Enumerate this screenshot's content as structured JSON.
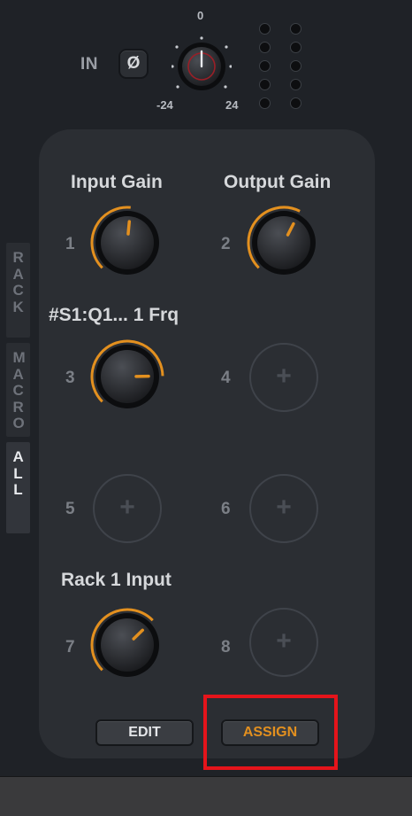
{
  "input": {
    "label": "IN",
    "phase_symbol": "Ø",
    "scale_top": "0",
    "scale_min": "-24",
    "scale_max": "24"
  },
  "side_tabs": [
    {
      "label": "RACK",
      "active": false
    },
    {
      "label": "MACRO",
      "active": false
    },
    {
      "label": "ALL",
      "active": true
    }
  ],
  "macros": [
    {
      "number": "1",
      "name": "Input Gain",
      "assigned": true,
      "value": 0.52
    },
    {
      "number": "2",
      "name": "Output Gain",
      "assigned": true,
      "value": 0.6
    },
    {
      "number": "3",
      "name": "#S1:Q1... 1 Frq",
      "assigned": true,
      "value": 0.83
    },
    {
      "number": "4",
      "name": "",
      "assigned": false
    },
    {
      "number": "5",
      "name": "",
      "assigned": false
    },
    {
      "number": "6",
      "name": "",
      "assigned": false
    },
    {
      "number": "7",
      "name": "Rack 1 Input",
      "assigned": true,
      "value": 0.67
    },
    {
      "number": "8",
      "name": "",
      "assigned": false
    }
  ],
  "buttons": {
    "edit": "EDIT",
    "assign": "ASSIGN"
  },
  "add_symbol": "+",
  "colors": {
    "accent": "#e3901f",
    "highlight": "#e5141b",
    "input_indicator": "#9a1f27"
  }
}
